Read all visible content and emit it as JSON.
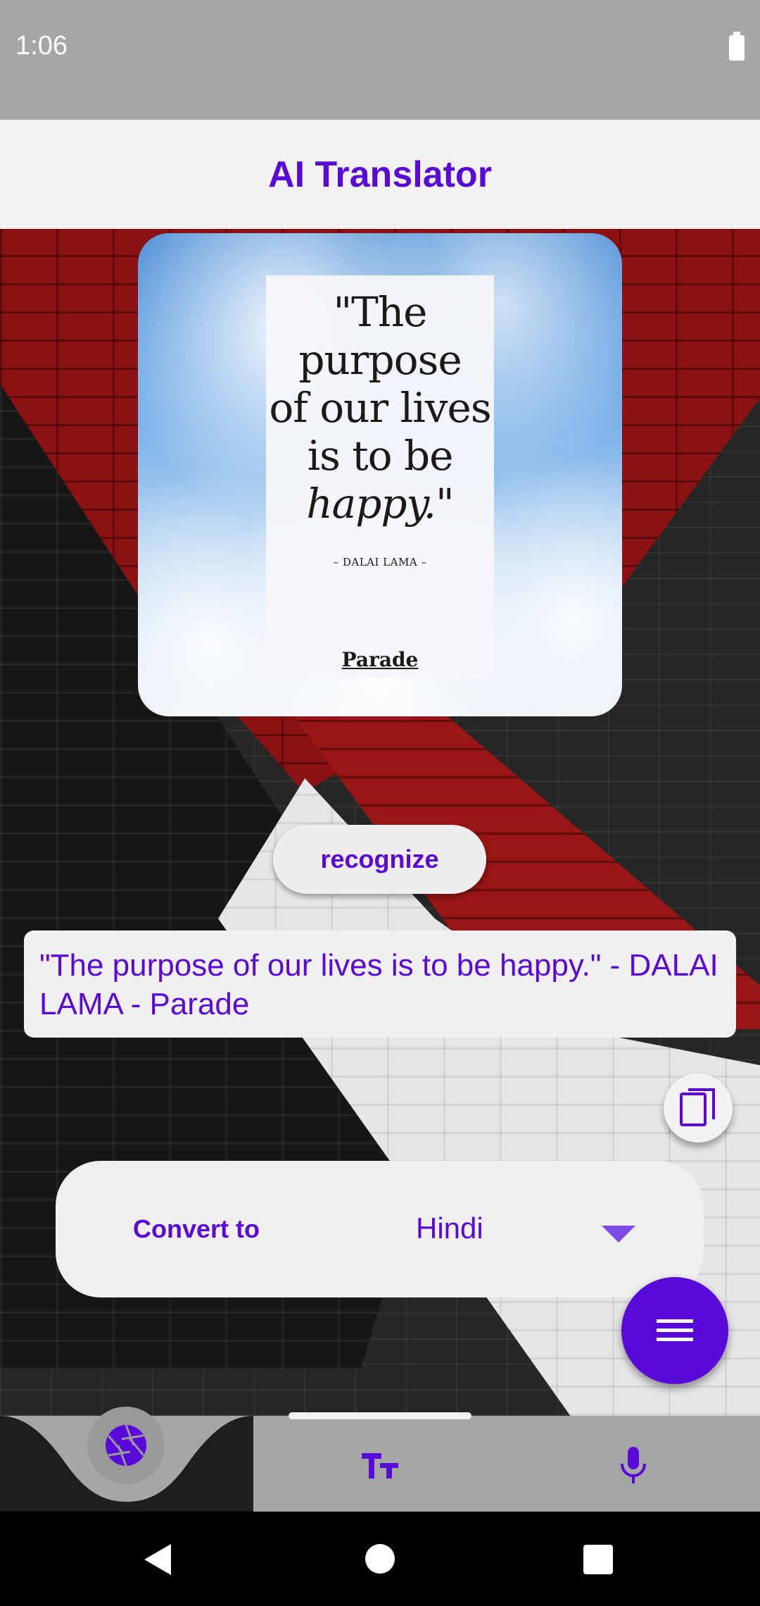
{
  "status_bar": {
    "time": "1:06"
  },
  "app_bar": {
    "title": "AI Translator"
  },
  "image": {
    "quote_lines": [
      "\"The",
      "purpose",
      "of our lives",
      "is to be",
      "happy.\""
    ],
    "author": "– DALAI LAMA –",
    "brand": "Parade"
  },
  "actions": {
    "recognize_label": "recognize"
  },
  "result": {
    "text": " \"The purpose of our lives is to be happy.\" - DALAI LAMA - Parade"
  },
  "convert": {
    "label": "Convert to",
    "language": "Hindi"
  },
  "icons": {
    "copy": "copy-icon",
    "menu": "menu-icon",
    "camera": "camera-aperture-icon",
    "text_size": "text-size-icon",
    "mic": "microphone-icon"
  },
  "colors": {
    "accent": "#5a0ad8",
    "panel": "#efefef",
    "bar": "#a6a6a6"
  }
}
